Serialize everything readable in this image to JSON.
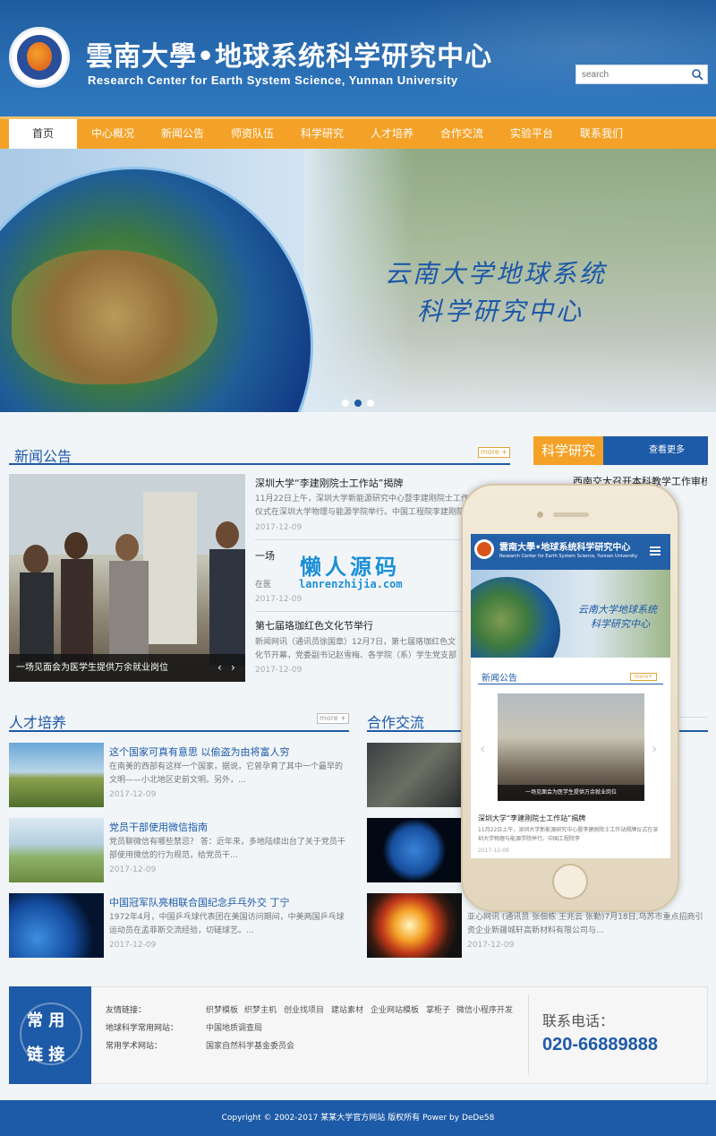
{
  "header": {
    "title_cn": "雲南大學•地球系统科学研究中心",
    "title_en": "Research Center for Earth System Science,  Yunnan University",
    "search_placeholder": "search"
  },
  "nav": [
    "首页",
    "中心概况",
    "新闻公告",
    "师资队伍",
    "科学研究",
    "人才培养",
    "合作交流",
    "实验平台",
    "联系我们"
  ],
  "banner": {
    "line1": "云南大学地球系统",
    "line2": "科学研究中心"
  },
  "news": {
    "title": "新闻公告",
    "more": "more +",
    "caption": "一场见面会为医学生提供万余就业岗位",
    "items": [
      {
        "title": "深圳大学“李建刚院士工作站”揭牌",
        "desc": "11月22日上午，深圳大学新能源研究中心暨李建刚院士工作站揭牌仪式在深圳大学物理与能源学院举行。中国工程院李建刚院士",
        "date": "2017-12-09"
      },
      {
        "title": "一场",
        "desc": "在医",
        "date": "2017-12-09"
      },
      {
        "title": "第七届珞珈红色文化节举行",
        "desc": "新闻网讯（通讯员徐国章）12月7日，第七届珞珈红色文化节开幕，党委副书记赵雪梅、各学院（系）学生党支部书记代表及",
        "date": "2017-12-09"
      }
    ]
  },
  "science": {
    "title": "科学研究",
    "more": "查看更多",
    "items": [
      "西南交大召开本科教学工作审核"
    ]
  },
  "talent": {
    "title": "人才培养",
    "more": "more +",
    "items": [
      {
        "title": "这个国家可真有意思 以偷盗为由将富人穷",
        "desc": "在南美的西部有这样一个国家，据说，它曾孕育了其中一个最早的文明——小北地区史前文明。另外，...",
        "date": "2017-12-09"
      },
      {
        "title": "党员干部使用微信指南",
        "desc": "党员聊微信有哪些禁忌？ 答：近年来，多地陆续出台了关于党员干部使用微信的行为规范，给党员干...",
        "date": "2017-12-09"
      },
      {
        "title": "中国冠军队亮相联合国纪念乒乓外交 丁宁",
        "desc": "1972年4月，中国乒乓球代表团在美国访问期间，中美两国乒乓球运动员在孟菲斯交流经验，切磋球艺。...",
        "date": "2017-12-09"
      }
    ]
  },
  "coop": {
    "title": "合作交流",
    "last_desc": "亚心网讯 (通讯员 张佃栋 王兆云 张勤)7月18日,乌苏市重点招商引资企业新疆城轩高新材料有限公司与...",
    "last_date": "2017-12-09"
  },
  "phone": {
    "title_cn": "雲南大學•地球系统科学研究中心",
    "title_en": "Research Center for Earth System Science,  Yunnan University",
    "banner_line1": "云南大学地球系统",
    "banner_line2": "科学研究中心",
    "news_title": "新闻公告",
    "more": "more+",
    "caption": "一场见面会为医学生提供万余就业岗位",
    "item_title": "深圳大学“李建刚院士工作站”揭牌",
    "item_desc": "11月22日上午，深圳大学新能源研究中心暨李建刚院士工作站揭牌仪式在深圳大学物理与能源学院举行。中国工程院李",
    "item_date": "2017-12-09"
  },
  "watermark": {
    "cn": "懒人源码",
    "url": "lanrenzhijia.com"
  },
  "links": {
    "box_line1": "常 用",
    "box_line2": "链 接",
    "rows": [
      {
        "label": "友情链接：",
        "items": [
          "织梦模板",
          "织梦主机",
          "创业找项目",
          "建站素材",
          "企业网站模板",
          "掌柜子",
          "微信小程序开发"
        ]
      },
      {
        "label": "地球科学常用网站：",
        "items": [
          "中国地质调查局"
        ]
      },
      {
        "label": "常用学术网站：",
        "items": [
          "国家自然科学基金委员会"
        ]
      }
    ],
    "phone_label": "联系电话：",
    "phone_number": "020-66889888"
  },
  "footer": {
    "copyright": "Copyright © 2002-2017 某某大学官方网站 版权所有 Power by DeDe58"
  },
  "colors": {
    "primary": "#1d5aa7",
    "accent": "#f4a227"
  }
}
